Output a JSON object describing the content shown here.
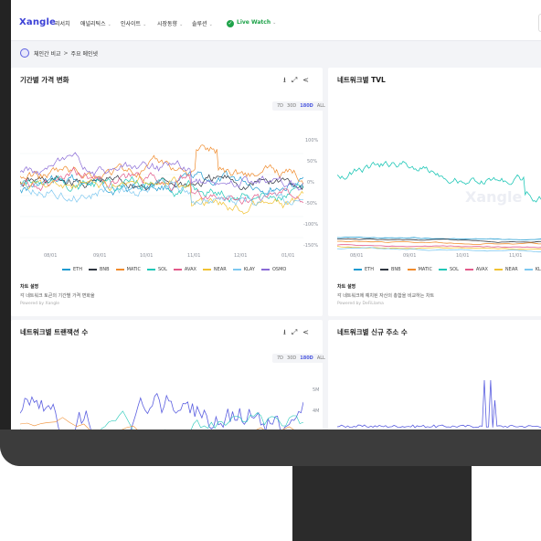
{
  "nav": {
    "logo": "Xangle",
    "items": [
      {
        "label": "리서치",
        "has_dropdown": false
      },
      {
        "label": "애널리틱스",
        "has_dropdown": true
      },
      {
        "label": "인사이트",
        "has_dropdown": true
      },
      {
        "label": "시장동향",
        "has_dropdown": true
      },
      {
        "label": "솔루션",
        "has_dropdown": true
      }
    ],
    "live_watch": "Live Watch",
    "chevron": "⌄"
  },
  "breadcrumb": {
    "parent": "체인간 비교",
    "separator": ">",
    "current": "주요 메인넷"
  },
  "panels": {
    "price": {
      "title": "기간별 가격 변화",
      "ranges": [
        "7D",
        "30D",
        "180D",
        "ALL"
      ],
      "active_range": "180D",
      "y_ticks": [
        "100%",
        "50%",
        "0%",
        "-50%",
        "-100%",
        "-150%"
      ],
      "x_ticks": [
        "08/01",
        "09/01",
        "10/01",
        "11/01",
        "12/01",
        "01/01"
      ],
      "legend": [
        {
          "name": "ETH",
          "color": "#1f9bd1"
        },
        {
          "name": "BNB",
          "color": "#2f3640"
        },
        {
          "name": "MATIC",
          "color": "#f08b2c"
        },
        {
          "name": "SOL",
          "color": "#20c7b7"
        },
        {
          "name": "AVAX",
          "color": "#e35a8a"
        },
        {
          "name": "NEAR",
          "color": "#f1c232"
        },
        {
          "name": "KLAY",
          "color": "#7ec8f0"
        },
        {
          "name": "OSMO",
          "color": "#8a6bd6"
        }
      ],
      "note_title": "차트 설명",
      "note_text": "각 네트워크 토큰의 기간별 가격 변화율",
      "powered": "Powered by Xangle"
    },
    "tvl": {
      "title": "네트워크별 TVL",
      "x_ticks": [
        "08/01",
        "09/01",
        "10/01",
        "11/01"
      ],
      "legend": [
        {
          "name": "ETH",
          "color": "#1f9bd1"
        },
        {
          "name": "BNB",
          "color": "#2f3640"
        },
        {
          "name": "MATIC",
          "color": "#f08b2c"
        },
        {
          "name": "SOL",
          "color": "#20c7b7"
        },
        {
          "name": "AVAX",
          "color": "#e35a8a"
        },
        {
          "name": "NEAR",
          "color": "#f1c232"
        },
        {
          "name": "KLAY",
          "color": "#7ec8f0"
        }
      ],
      "note_title": "차트 설명",
      "note_text": "각 네트워크에 예치된 자산의 총합을 비교하는 차트",
      "powered": "Powered by DeFiLlama",
      "watermark": "Xangle"
    },
    "tx": {
      "title": "네트워크별 트랜잭션 수",
      "ranges": [
        "7D",
        "30D",
        "180D",
        "ALL"
      ],
      "active_range": "180D",
      "y_ticks": [
        "5M",
        "4M"
      ]
    },
    "addr": {
      "title": "네트워크별 신규 주소 수"
    }
  },
  "tools": {
    "download": "⭳",
    "expand": "⤢",
    "share": "<"
  },
  "colors": {
    "accent": "#4f5be0",
    "live": "#1fa34a",
    "logo": "#3a3fd6"
  }
}
